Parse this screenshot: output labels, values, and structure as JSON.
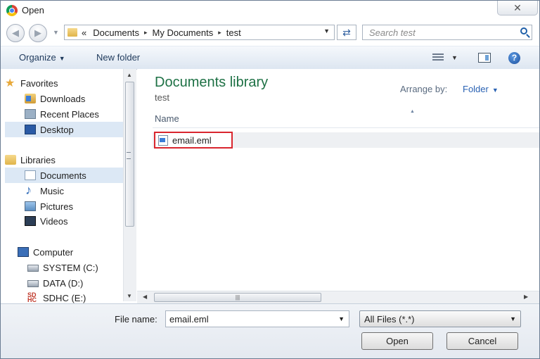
{
  "window": {
    "title": "Open",
    "close_glyph": "✕"
  },
  "address": {
    "overflow": "«",
    "crumbs": [
      "Documents",
      "My Documents",
      "test"
    ],
    "separator": "▸"
  },
  "search": {
    "placeholder": "Search test"
  },
  "toolbar": {
    "organize": "Organize",
    "new_folder": "New folder",
    "help": "?"
  },
  "nav": {
    "favorites": "Favorites",
    "downloads": "Downloads",
    "recent_places": "Recent Places",
    "desktop": "Desktop",
    "libraries": "Libraries",
    "documents": "Documents",
    "music": "Music",
    "pictures": "Pictures",
    "videos": "Videos",
    "computer": "Computer",
    "drive_c": "SYSTEM (C:)",
    "drive_d": "DATA (D:)",
    "drive_e": "SDHC (E:)",
    "sd_text": "SD HC"
  },
  "content": {
    "library_title": "Documents library",
    "library_subtitle": "test",
    "arrange_label": "Arrange by:",
    "arrange_value": "Folder",
    "column_name": "Name",
    "files": [
      {
        "name": "email.eml"
      }
    ]
  },
  "bottom": {
    "file_name_label": "File name:",
    "file_name_value": "email.eml",
    "file_type": "All Files (*.*)",
    "open": "Open",
    "cancel": "Cancel"
  },
  "colors": {
    "library_title": "#1e7145",
    "selection_highlight": "#d9262e",
    "link": "#2a62b3"
  }
}
